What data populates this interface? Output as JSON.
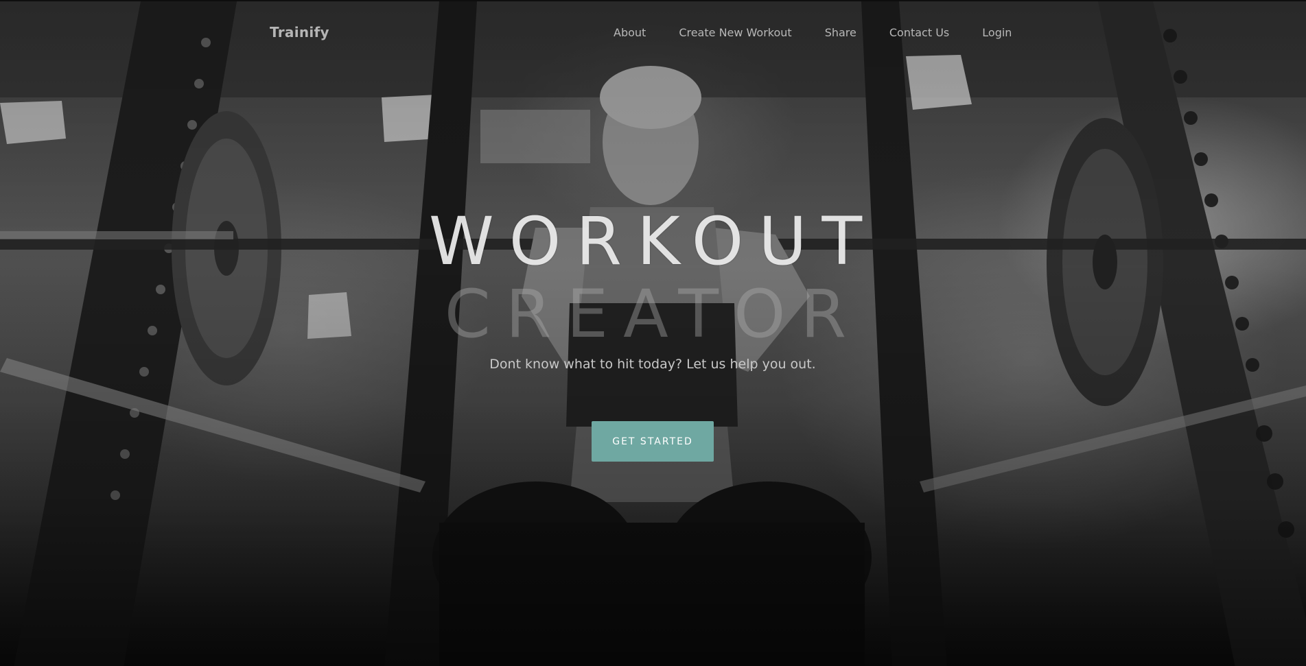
{
  "nav": {
    "brand": "Trainify",
    "links": [
      {
        "label": "About"
      },
      {
        "label": "Create New Workout"
      },
      {
        "label": "Share"
      },
      {
        "label": "Contact Us"
      },
      {
        "label": "Login"
      }
    ]
  },
  "hero": {
    "title_line1": "WORKOUT",
    "title_line2": "CREATOR",
    "subtitle": "Dont know what to hit today? Let us help you out.",
    "cta_label": "GET STARTED",
    "background_image": "gym-squat-photo-grayscale"
  },
  "colors": {
    "accent": "#6fa8a2",
    "nav_text": "#b8b8b8"
  }
}
